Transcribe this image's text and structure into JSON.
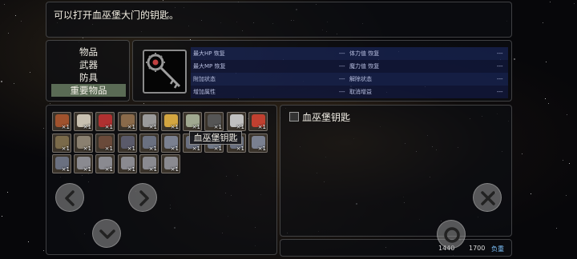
{
  "description": "可以打开血巫堡大门的钥匙。",
  "categories": [
    {
      "label": "物品",
      "selected": false
    },
    {
      "label": "武器",
      "selected": false
    },
    {
      "label": "防具",
      "selected": false
    },
    {
      "label": "重要物品",
      "selected": true
    }
  ],
  "stats": {
    "rows": [
      {
        "left_label": "最大HP 恢复",
        "left_value": "---",
        "right_label": "体力值 恢复",
        "right_value": "---"
      },
      {
        "left_label": "最大MP 恢复",
        "left_value": "---",
        "right_label": "魔力值 恢复",
        "right_value": "---"
      },
      {
        "left_label": "附加状态",
        "left_value": "---",
        "right_label": "解除状态",
        "right_value": "---"
      },
      {
        "left_label": "增加属性",
        "left_value": "---",
        "right_label": "取消增益",
        "right_value": "---"
      }
    ]
  },
  "inventory": {
    "items": [
      {
        "icon": "potion-icon",
        "qty": "×1",
        "color": "#a0522d"
      },
      {
        "icon": "scroll-icon",
        "qty": "×1",
        "color": "#c8c0b0"
      },
      {
        "icon": "flask-icon",
        "qty": "×1",
        "color": "#b03030"
      },
      {
        "icon": "book-icon",
        "qty": "×1",
        "color": "#8a6a4a"
      },
      {
        "icon": "scroll-icon",
        "qty": "×1",
        "color": "#9a9a9a"
      },
      {
        "icon": "orb-pair-icon",
        "qty": "×1",
        "color": "#d4a640"
      },
      {
        "icon": "map-icon",
        "qty": "×1",
        "color": "#a0a890"
      },
      {
        "icon": "bell-icon",
        "qty": "×1",
        "color": "#555555"
      },
      {
        "icon": "scroll-icon",
        "qty": "×1",
        "color": "#c0c0c0"
      },
      {
        "icon": "flask-icon",
        "qty": "×1",
        "color": "#c04030"
      },
      {
        "icon": "sack-icon",
        "qty": "×1",
        "color": "#7a6a4a"
      },
      {
        "icon": "key-icon",
        "qty": "×1",
        "color": "#8a8070"
      },
      {
        "icon": "book-icon",
        "qty": "×1",
        "color": "#6a4a3a"
      },
      {
        "icon": "book-icon",
        "qty": "×1",
        "color": "#5a5a6a"
      },
      {
        "icon": "book-icon",
        "qty": "×1",
        "color": "#6a7080"
      },
      {
        "icon": "book-icon",
        "qty": "×1",
        "color": "#7a8090"
      },
      {
        "icon": "book-icon",
        "qty": "×1",
        "color": "#6a7080"
      },
      {
        "icon": "book-icon",
        "qty": "×1",
        "color": "#707888"
      },
      {
        "icon": "book-icon",
        "qty": "×1",
        "color": "#6a7080"
      },
      {
        "icon": "book-icon",
        "qty": "×1",
        "color": "#7a8090"
      },
      {
        "icon": "book-icon",
        "qty": "×1",
        "color": "#6a7080"
      },
      {
        "icon": "book-icon",
        "qty": "×1",
        "color": "#8a8a90"
      },
      {
        "icon": "book-icon",
        "qty": "×1",
        "color": "#8a8a90"
      },
      {
        "icon": "book-icon",
        "qty": "×1",
        "color": "#8a8a90"
      },
      {
        "icon": "book-icon",
        "qty": "×1",
        "color": "#8a8a90"
      },
      {
        "icon": "book-icon",
        "qty": "×1",
        "color": "#8a8a90"
      }
    ],
    "tooltip": "血巫堡钥匙"
  },
  "detail": {
    "name": "血巫堡钥匙"
  },
  "weight": {
    "current": "1440",
    "max": "1700",
    "label": "负重"
  },
  "controls": {
    "prev": "chevron-left-icon",
    "next": "chevron-right-icon",
    "down": "chevron-down-icon",
    "close": "close-icon",
    "confirm": "circle-icon"
  },
  "colors": {
    "selected_category": "#5a6b55",
    "stat_row": "#1e2d6e",
    "weight_label": "#7fc4ff"
  }
}
